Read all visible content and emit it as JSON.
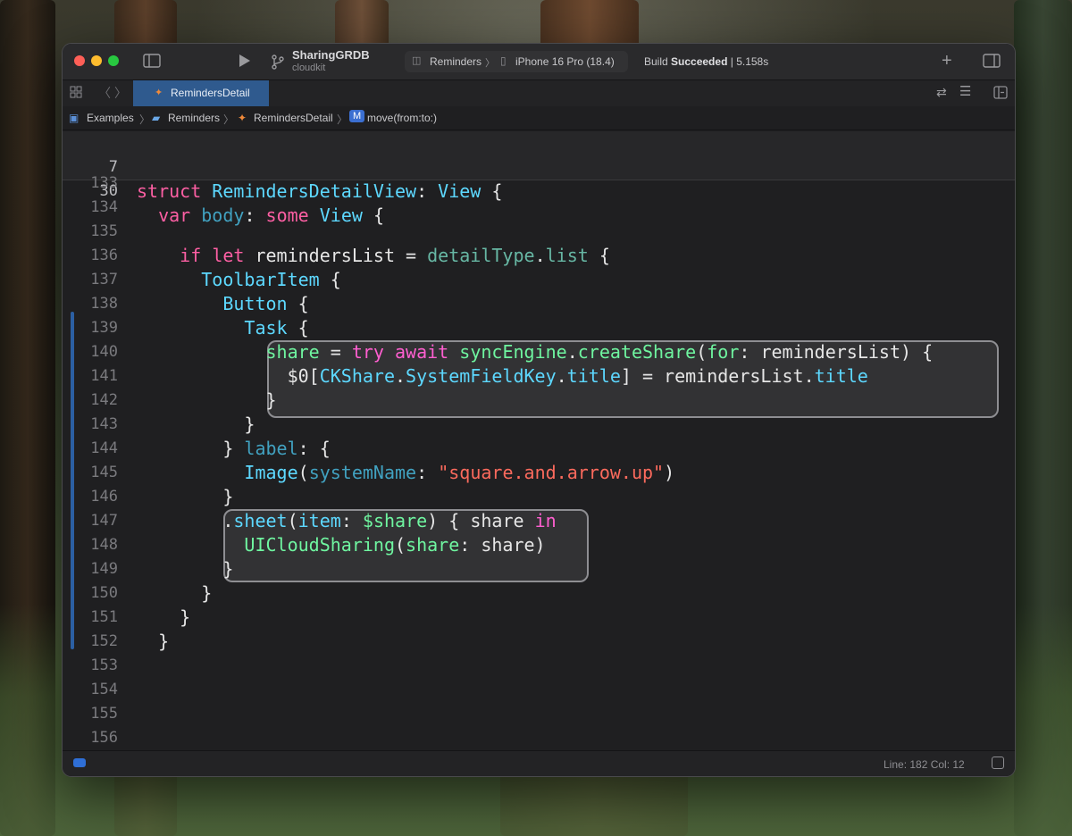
{
  "project": {
    "name": "SharingGRDB",
    "branch": "cloudkit"
  },
  "scheme": {
    "target": "Reminders",
    "device": "iPhone 16 Pro (18.4)"
  },
  "build": {
    "prefix": "Build ",
    "state": "Succeeded",
    "sep": " | ",
    "time": "5.158s"
  },
  "tab": {
    "label": "RemindersDetail"
  },
  "breadcrumb": {
    "items": [
      "Examples",
      "Reminders",
      "RemindersDetail"
    ],
    "method_badge": "M",
    "method": "move(from:to:)"
  },
  "sticky": [
    {
      "num": "7",
      "tokens": [
        [
          "kw",
          "struct"
        ],
        [
          "pl",
          " "
        ],
        [
          "ty",
          "RemindersDetailView"
        ],
        [
          "pl",
          ": "
        ],
        [
          "ty",
          "View"
        ],
        [
          "pl",
          " {"
        ]
      ]
    },
    {
      "num": "30",
      "tokens": [
        [
          "pl",
          "  "
        ],
        [
          "kw",
          "var"
        ],
        [
          "pl",
          " "
        ],
        [
          "pr",
          "body"
        ],
        [
          "pl",
          ": "
        ],
        [
          "kw",
          "some"
        ],
        [
          "pl",
          " "
        ],
        [
          "ty",
          "View"
        ],
        [
          "pl",
          " {"
        ]
      ]
    }
  ],
  "lines": [
    {
      "num": "133",
      "tokens": []
    },
    {
      "num": "134",
      "tokens": []
    },
    {
      "num": "135",
      "tokens": []
    },
    {
      "num": "136",
      "tokens": [
        [
          "pl",
          "    "
        ],
        [
          "kw",
          "if"
        ],
        [
          "pl",
          " "
        ],
        [
          "kw",
          "let"
        ],
        [
          "pl",
          " remindersList = "
        ],
        [
          "fn",
          "detailType"
        ],
        [
          "pl",
          "."
        ],
        [
          "fn",
          "list"
        ],
        [
          "pl",
          " {"
        ]
      ]
    },
    {
      "num": "137",
      "tokens": [
        [
          "pl",
          "      "
        ],
        [
          "ty",
          "ToolbarItem"
        ],
        [
          "pl",
          " {"
        ]
      ]
    },
    {
      "num": "138",
      "tokens": [
        [
          "pl",
          "        "
        ],
        [
          "ty",
          "Button"
        ],
        [
          "pl",
          " {"
        ]
      ]
    },
    {
      "num": "139",
      "tokens": [
        [
          "pl",
          "          "
        ],
        [
          "ty",
          "Task"
        ],
        [
          "pl",
          " {"
        ]
      ]
    },
    {
      "num": "140",
      "tokens": [
        [
          "pl",
          "            "
        ],
        [
          "hl-fn",
          "share"
        ],
        [
          "hl",
          " = "
        ],
        [
          "hl-kw",
          "try"
        ],
        [
          "hl",
          " "
        ],
        [
          "hl-kw",
          "await"
        ],
        [
          "hl",
          " "
        ],
        [
          "hl-fn",
          "syncEngine"
        ],
        [
          "hl",
          "."
        ],
        [
          "hl-fn",
          "createShare"
        ],
        [
          "hl",
          "("
        ],
        [
          "hl-fn",
          "for"
        ],
        [
          "hl",
          ": remindersList) {"
        ]
      ]
    },
    {
      "num": "141",
      "tokens": [
        [
          "pl",
          "              "
        ],
        [
          "hl",
          "$0["
        ],
        [
          "hl-ty",
          "CKShare"
        ],
        [
          "hl",
          "."
        ],
        [
          "hl-ty",
          "SystemFieldKey"
        ],
        [
          "hl",
          "."
        ],
        [
          "hl-ty",
          "title"
        ],
        [
          "hl",
          "] = remindersList."
        ],
        [
          "hl-ty",
          "title"
        ]
      ]
    },
    {
      "num": "142",
      "tokens": [
        [
          "pl",
          "            "
        ],
        [
          "hl",
          "}"
        ]
      ]
    },
    {
      "num": "143",
      "tokens": [
        [
          "pl",
          "          }"
        ]
      ]
    },
    {
      "num": "144",
      "tokens": [
        [
          "pl",
          "        } "
        ],
        [
          "pr",
          "label"
        ],
        [
          "pl",
          ": {"
        ]
      ]
    },
    {
      "num": "145",
      "tokens": [
        [
          "pl",
          "          "
        ],
        [
          "ty",
          "Image"
        ],
        [
          "pl",
          "("
        ],
        [
          "pr",
          "systemName"
        ],
        [
          "pl",
          ": "
        ],
        [
          "st",
          "\"square.and.arrow.up\""
        ],
        [
          "pl",
          ")"
        ]
      ]
    },
    {
      "num": "146",
      "tokens": [
        [
          "pl",
          "        }"
        ]
      ]
    },
    {
      "num": "147",
      "tokens": [
        [
          "pl",
          "        "
        ],
        [
          "hl",
          "."
        ],
        [
          "hl-ty",
          "sheet"
        ],
        [
          "hl",
          "("
        ],
        [
          "hl-ty",
          "item"
        ],
        [
          "hl",
          ": "
        ],
        [
          "hl-fn",
          "$share"
        ],
        [
          "hl",
          ") { share "
        ],
        [
          "hl-kw",
          "in"
        ]
      ]
    },
    {
      "num": "148",
      "tokens": [
        [
          "pl",
          "          "
        ],
        [
          "hl-fn",
          "UICloudSharing"
        ],
        [
          "hl",
          "("
        ],
        [
          "hl-fn",
          "share"
        ],
        [
          "hl",
          ": share)"
        ]
      ]
    },
    {
      "num": "149",
      "tokens": [
        [
          "pl",
          "        "
        ],
        [
          "hl",
          "}"
        ]
      ]
    },
    {
      "num": "150",
      "tokens": [
        [
          "pl",
          "      }"
        ]
      ]
    },
    {
      "num": "151",
      "tokens": [
        [
          "pl",
          "    }"
        ]
      ]
    },
    {
      "num": "152",
      "tokens": [
        [
          "pl",
          "  }"
        ]
      ]
    },
    {
      "num": "153",
      "tokens": []
    },
    {
      "num": "154",
      "tokens": []
    },
    {
      "num": "155",
      "tokens": []
    },
    {
      "num": "156",
      "tokens": []
    }
  ],
  "status": {
    "position": "Line: 182  Col: 12"
  },
  "icons": [
    "sidebar-toggle-icon",
    "run-icon",
    "branch-icon",
    "add-icon",
    "inspector-toggle-icon",
    "grid-icon",
    "back-icon",
    "forward-icon",
    "swift-icon",
    "folder-icon",
    "refresh-icon",
    "editor-options-icon",
    "split-editor-icon",
    "debug-area-icon"
  ]
}
